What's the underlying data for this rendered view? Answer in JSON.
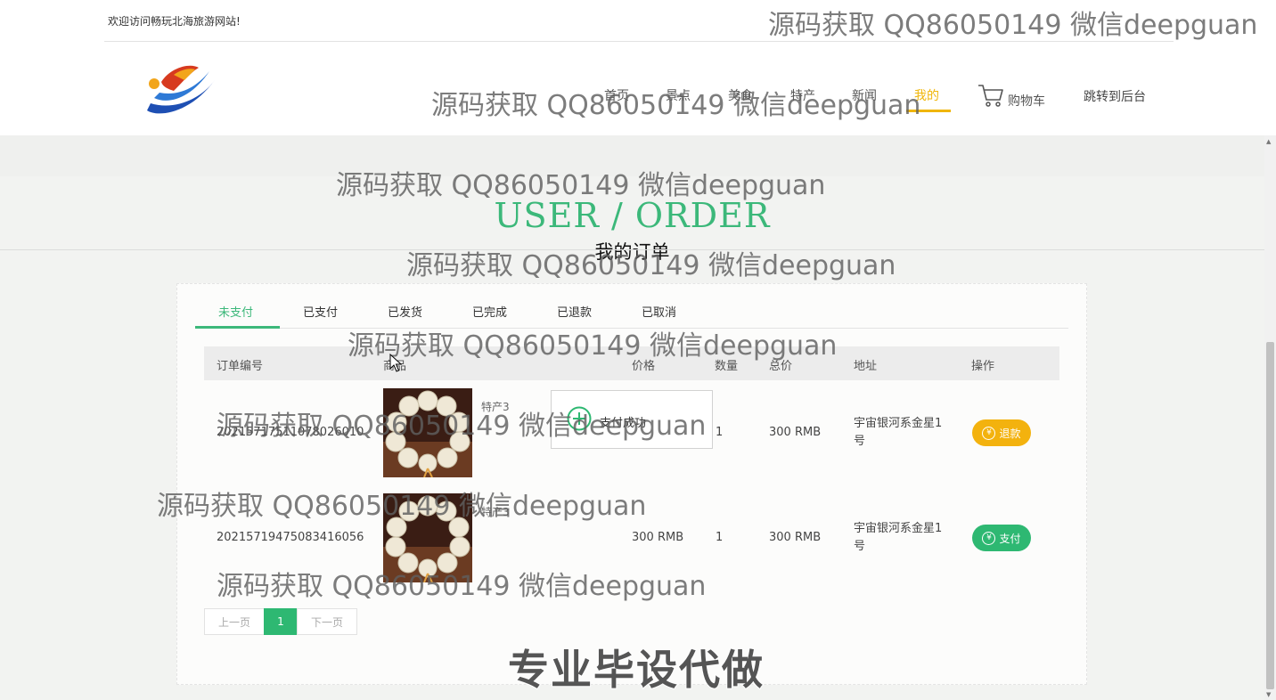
{
  "header": {
    "welcome": "欢迎访问畅玩北海旅游网站!",
    "nav": [
      "首页",
      "景点",
      "美食",
      "特产",
      "新闻",
      "我的"
    ],
    "cart_label": "购物车",
    "admin_link": "跳转到后台"
  },
  "banner": {
    "title_en": "USER / ORDER",
    "title_zh": "我的订单"
  },
  "tabs": [
    "未支付",
    "已支付",
    "已发货",
    "已完成",
    "已退款",
    "已取消"
  ],
  "table": {
    "headers": [
      "订单编号",
      "商品",
      "价格",
      "数量",
      "总价",
      "地址",
      "操作"
    ],
    "rows": [
      {
        "order_no": "20215717511078026010",
        "product": "特产3",
        "price": "",
        "qty": "1",
        "total": "300 RMB",
        "address": "宇宙银河系金星1号",
        "action": "退款"
      },
      {
        "order_no": "20215719475083416056",
        "product": "特产3",
        "price": "300 RMB",
        "qty": "1",
        "total": "300 RMB",
        "address": "宇宙银河系金星1号",
        "action": "支付"
      }
    ]
  },
  "toast": {
    "text": "支付成功"
  },
  "pagination": {
    "prev": "上一页",
    "current": "1",
    "next": "下一页"
  },
  "watermarks": {
    "line": "源码获取 QQ86050149 微信deepguan",
    "bottom": "专业毕设代做"
  },
  "icons": {
    "cart": "shopping-cart-icon",
    "coin": "yuan-coin-icon",
    "success": "success-icon",
    "logo": "site-logo"
  },
  "colors": {
    "accent_green": "#3cb87a",
    "active_nav": "#f0b60a",
    "refund_button": "#f3b20e",
    "pay_button": "#2eb872"
  }
}
